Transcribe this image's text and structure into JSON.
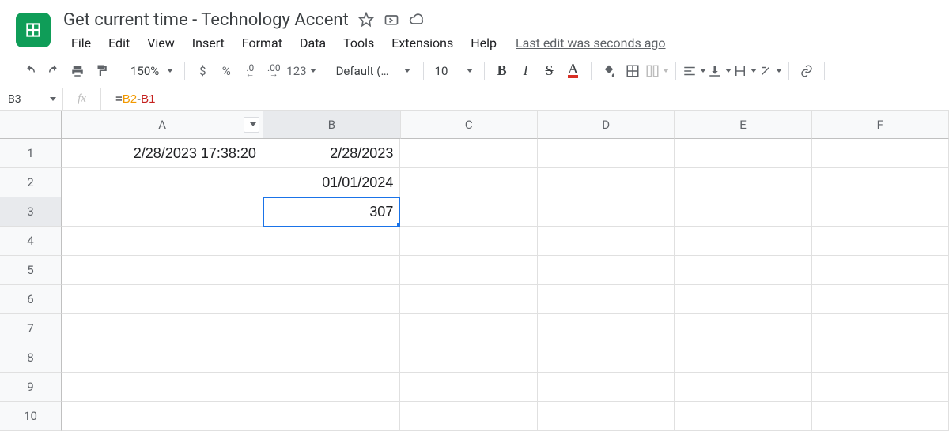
{
  "title": "Get current time - Technology Accent",
  "menu": {
    "file": "File",
    "edit": "Edit",
    "view": "View",
    "insert": "Insert",
    "format": "Format",
    "data": "Data",
    "tools": "Tools",
    "extensions": "Extensions",
    "help": "Help",
    "last_edit": "Last edit was seconds ago"
  },
  "toolbar": {
    "zoom": "150%",
    "currency": "$",
    "percent": "%",
    "dec_dec": ".0",
    "dec_inc": ".00",
    "numfmt": "123",
    "font": "Default (Ari…",
    "fontsize": "10"
  },
  "namebox": "B3",
  "formula": {
    "eq": "=",
    "ref1": "B2",
    "op": "-",
    "ref2": "B1"
  },
  "columns": [
    "A",
    "B",
    "C",
    "D",
    "E",
    "F"
  ],
  "rows": [
    "1",
    "2",
    "3",
    "4",
    "5",
    "6",
    "7",
    "8",
    "9",
    "10"
  ],
  "cells": {
    "A1": "2/28/2023 17:38:20",
    "B1": "2/28/2023",
    "B2": "01/01/2024",
    "B3": "307"
  },
  "selected": "B3"
}
